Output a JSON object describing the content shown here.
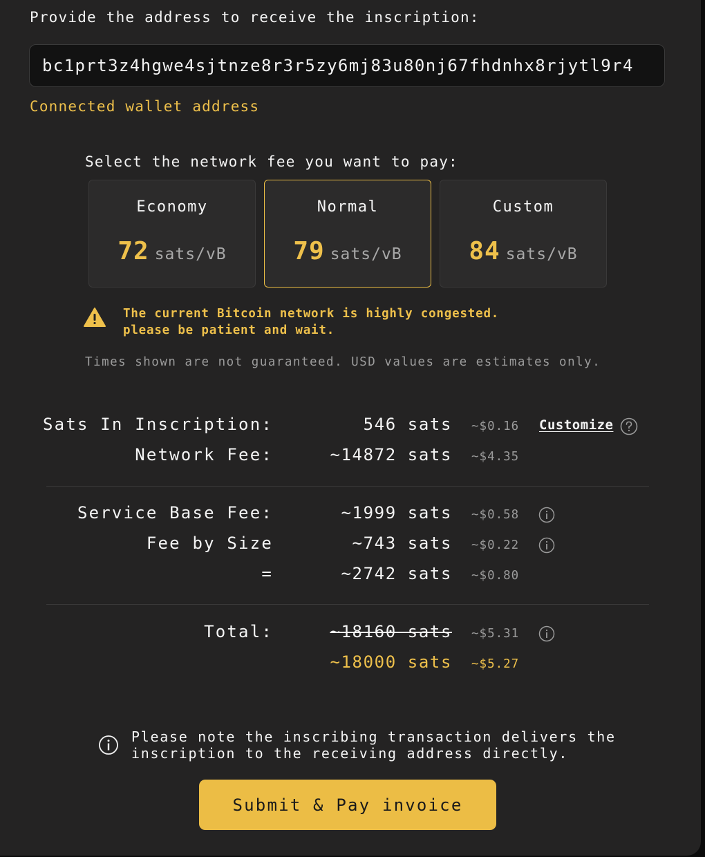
{
  "address_section": {
    "title": "Provide the address to receive the inscription:",
    "address_value": "bc1prt3z4hgwe4sjtnze8r3r5zy6mj83u80nj67fhdnhx8rjytl9r4",
    "connected_label": "Connected wallet address"
  },
  "fee_section": {
    "title": "Select the network fee you want to pay:",
    "options": [
      {
        "name": "Economy",
        "rate": "72",
        "unit": "sats/vB",
        "selected": false
      },
      {
        "name": "Normal",
        "rate": "79",
        "unit": "sats/vB",
        "selected": true
      },
      {
        "name": "Custom",
        "rate": "84",
        "unit": "sats/vB",
        "selected": false
      }
    ],
    "warning_line1": "The current Bitcoin network is highly congested.",
    "warning_line2": "please be patient and wait.",
    "disclaimer": "Times shown are not guaranteed. USD values are estimates only."
  },
  "summary": {
    "sats_in_inscription": {
      "label": "Sats In Inscription:",
      "value": "546 sats",
      "usd": "~$0.16"
    },
    "customize_label": "Customize",
    "network_fee": {
      "label": "Network Fee:",
      "value": "~14872 sats",
      "usd": "~$4.35"
    },
    "service_base_fee": {
      "label": "Service Base Fee:",
      "value": "~1999 sats",
      "usd": "~$0.58"
    },
    "fee_by_size": {
      "label": "Fee by Size",
      "value": "~743 sats",
      "usd": "~$0.22"
    },
    "subtotal": {
      "label": "=",
      "value": "~2742 sats",
      "usd": "~$0.80"
    },
    "total": {
      "label": "Total:",
      "original_value": "~18160 sats",
      "original_usd": "~$5.31",
      "value": "~18000 sats",
      "usd": "~$5.27"
    }
  },
  "note": {
    "line1": "Please note the inscribing transaction delivers the",
    "line2": "inscription to the receiving address directly."
  },
  "submit_label": "Submit & Pay invoice",
  "colors": {
    "accent": "#ecbd45",
    "panel": "#242323",
    "muted": "#9a9a9a"
  }
}
